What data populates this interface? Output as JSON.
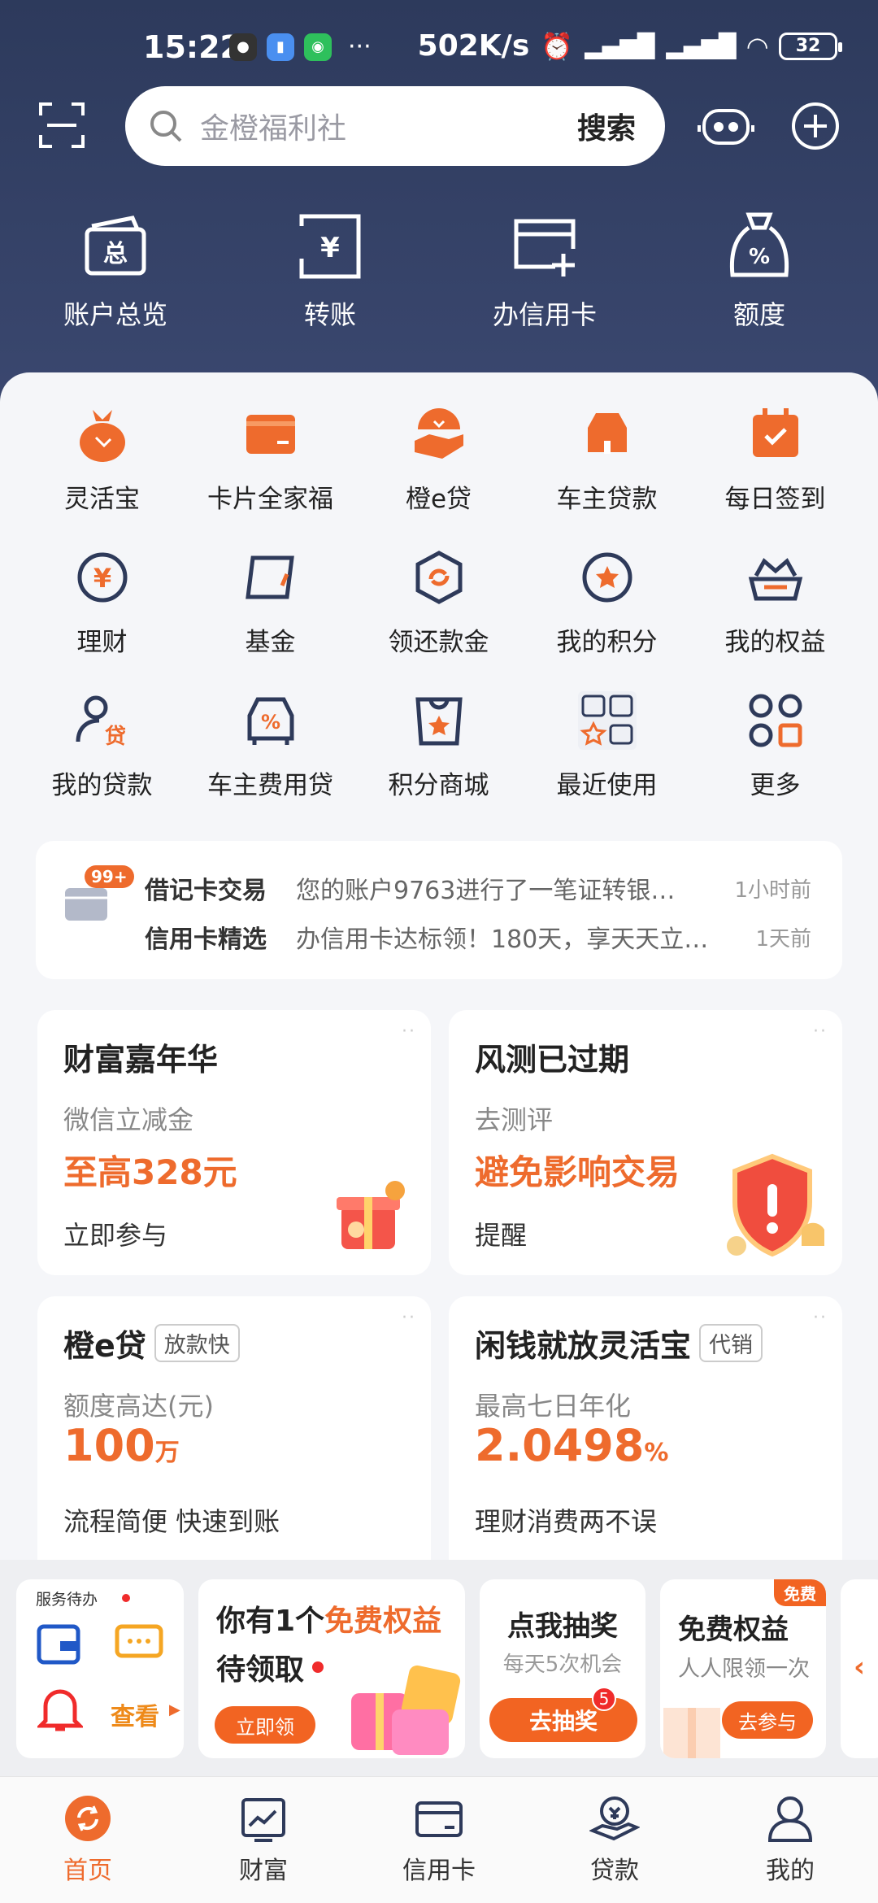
{
  "status_bar": {
    "time": "15:22",
    "more": "···",
    "speed": "502K/s",
    "battery": "32"
  },
  "search": {
    "placeholder": "金橙福利社",
    "button": "搜索"
  },
  "top_shortcuts": [
    {
      "label": "账户总览",
      "icon": "account-overview-icon"
    },
    {
      "label": "转账",
      "icon": "transfer-icon"
    },
    {
      "label": "办信用卡",
      "icon": "apply-card-icon"
    },
    {
      "label": "额度",
      "icon": "credit-limit-icon"
    }
  ],
  "functions": [
    [
      {
        "label": "灵活宝",
        "icon": "money-bag-icon"
      },
      {
        "label": "卡片全家福",
        "icon": "card-wallet-icon"
      },
      {
        "label": "橙e贷",
        "icon": "loan-hand-icon"
      },
      {
        "label": "车主贷款",
        "icon": "car-loan-icon"
      },
      {
        "label": "每日签到",
        "icon": "calendar-check-icon"
      }
    ],
    [
      {
        "label": "理财",
        "icon": "yuan-coin-icon"
      },
      {
        "label": "基金",
        "icon": "fund-icon"
      },
      {
        "label": "领还款金",
        "icon": "repay-reward-icon"
      },
      {
        "label": "我的积分",
        "icon": "points-star-icon"
      },
      {
        "label": "我的权益",
        "icon": "crown-basket-icon"
      }
    ],
    [
      {
        "label": "我的贷款",
        "icon": "user-loan-icon"
      },
      {
        "label": "车主费用贷",
        "icon": "car-percent-icon"
      },
      {
        "label": "积分商城",
        "icon": "shopping-bag-star-icon"
      },
      {
        "label": "最近使用",
        "icon": "recent-grid-icon"
      },
      {
        "label": "更多",
        "icon": "more-grid-icon"
      }
    ]
  ],
  "messages": {
    "badge": "99+",
    "items": [
      {
        "title": "借记卡交易",
        "content": "您的账户9763进行了一笔证转银…",
        "time": "1小时前"
      },
      {
        "title": "信用卡精选",
        "content": "办信用卡达标领！180天，享天天立…",
        "time": "1天前"
      }
    ]
  },
  "promos": [
    {
      "title": "财富嘉年华",
      "sub": "微信立减金",
      "highlight": "至高328元",
      "action": "立即参与"
    },
    {
      "title": "风测已过期",
      "sub": "去测评",
      "highlight": "避免影响交易",
      "action": "提醒"
    },
    {
      "title": "橙e贷",
      "tag": "放款快",
      "sub": "额度高达(元)",
      "highlight": "100",
      "highlight_unit": "万",
      "action": "流程简便 快速到账"
    },
    {
      "title": "闲钱就放灵活宝",
      "tag": "代销",
      "sub": "最高七日年化",
      "highlight": "2.0498",
      "highlight_unit": "%",
      "action": "理财消费两不误"
    }
  ],
  "services": {
    "todo_label": "服务待办",
    "view": "查看",
    "benefit_title_1": "你有1个",
    "benefit_title_hl": "免费权益",
    "benefit_title_2": "待领取",
    "benefit_btn": "立即领",
    "lottery_title": "点我抽奖",
    "lottery_sub": "每天5次机会",
    "lottery_badge": "5",
    "lottery_btn": "去抽奖",
    "free_tag": "免费",
    "free_title": "免费权益",
    "free_sub": "人人限领一次",
    "free_btn": "去参与"
  },
  "nav": [
    {
      "label": "首页",
      "icon": "home-icon",
      "active": true
    },
    {
      "label": "财富",
      "icon": "wealth-chart-icon"
    },
    {
      "label": "信用卡",
      "icon": "credit-card-icon"
    },
    {
      "label": "贷款",
      "icon": "loan-icon"
    },
    {
      "label": "我的",
      "icon": "profile-icon"
    }
  ],
  "colors": {
    "accent": "#ee6b2d",
    "header": "#2d3a5c",
    "navy": "#2e3a5a"
  }
}
